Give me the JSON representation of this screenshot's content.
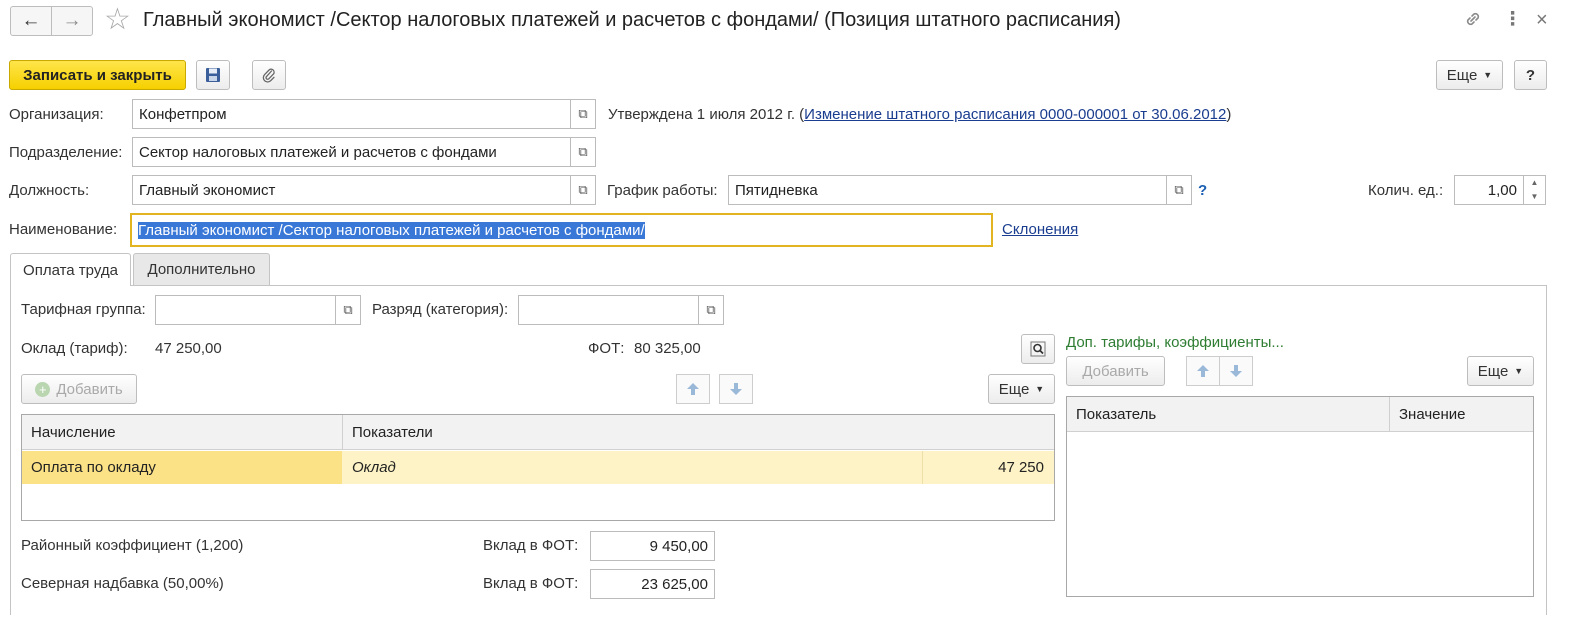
{
  "window": {
    "title": "Главный экономист /Сектор налоговых платежей и расчетов с фондами/ (Позиция штатного расписания)",
    "back_icon": "←",
    "forward_icon": "→",
    "star_icon": "☆",
    "link_icon": "🔗",
    "menu_icon": "⋮",
    "close_icon": "×"
  },
  "toolbar": {
    "save_close_label": "Записать и закрыть",
    "more_label": "Еще",
    "help_label": "?"
  },
  "form": {
    "org_label": "Организация:",
    "org_value": "Конфетпром",
    "approved_text": "Утверждена 1 июля 2012 г. (",
    "approved_link": "Изменение штатного расписания 0000-000001 от 30.06.2012",
    "approved_close": ")",
    "dept_label": "Подразделение:",
    "dept_value": "Сектор налоговых платежей и расчетов с фондами",
    "position_label": "Должность:",
    "position_value": "Главный экономист",
    "schedule_label": "График работы:",
    "schedule_value": "Пятидневка",
    "schedule_help": "?",
    "qty_label": "Колич. ед.:",
    "qty_value": "1,00",
    "name_label": "Наименование:",
    "name_value": "Главный экономист /Сектор налоговых платежей и расчетов с фондами/",
    "declension_link": "Склонения"
  },
  "tabs": [
    {
      "label": "Оплата труда"
    },
    {
      "label": "Дополнительно"
    }
  ],
  "pay": {
    "tariff_group_label": "Тарифная группа:",
    "tariff_group_value": "",
    "grade_label": "Разряд (категория):",
    "grade_value": "",
    "salary_label": "Оклад (тариф):",
    "salary_value": "47 250,00",
    "fot_label": "ФОТ:",
    "fot_value": "80 325,00",
    "add_label": "Добавить",
    "more_label": "Еще",
    "columns": [
      "Начисление",
      "Показатели"
    ],
    "rows": [
      {
        "accrual": "Оплата по окладу",
        "indicator": "Оклад",
        "value": "47 250"
      }
    ],
    "regional_label": "Районный коэффициент (1,200)",
    "regional_contrib_label": "Вклад в ФОТ:",
    "regional_contrib_value": "9 450,00",
    "north_label": "Северная надбавка (50,00%)",
    "north_contrib_label": "Вклад в ФОТ:",
    "north_contrib_value": "23 625,00"
  },
  "extra": {
    "title": "Доп. тарифы, коэффициенты...",
    "add_label": "Добавить",
    "more_label": "Еще",
    "columns": [
      "Показатель",
      "Значение"
    ]
  }
}
